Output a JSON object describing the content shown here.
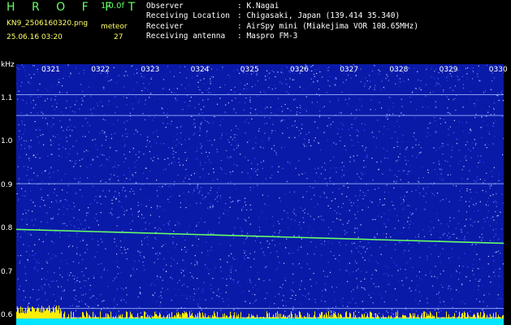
{
  "header": {
    "brand": "H R O F F T",
    "version": "1.0.0f",
    "file_name": "KN9_2506160320.png",
    "timestamp": "25.06.16 03:20",
    "meteor_label": "meteor",
    "meteor_count": "27",
    "colors": {
      "brand": "#66ff66",
      "version": "#66ff66",
      "meta": "#ffff66",
      "info": "#ffffff"
    }
  },
  "info": {
    "rows": [
      {
        "label": "Observer",
        "value": ": K.Nagai"
      },
      {
        "label": "Receiving Location",
        "value": ": Chigasaki, Japan (139.414 35.340)"
      },
      {
        "label": "Receiver",
        "value": ": AirSpy mini (Miakejima VOR 108.65MHz)"
      },
      {
        "label": "Receiving antenna",
        "value": ": Maspro FM-3"
      }
    ]
  },
  "chart_data": {
    "type": "heatmap",
    "ylabel": "kHz",
    "x_ticks": [
      "0321",
      "0322",
      "0323",
      "0324",
      "0325",
      "0326",
      "0327",
      "0328",
      "0329",
      "0330"
    ],
    "y_ticks": [
      "1.1",
      "1.0",
      "0.9",
      "0.8",
      "0.7",
      "0.6"
    ],
    "y_range": [
      0.58,
      1.18
    ],
    "carrier_line": {
      "start_khz": 0.8,
      "end_khz": 0.768
    },
    "horizontal_lines_khz": [
      1.11,
      1.062,
      0.905,
      0.618,
      0.597
    ],
    "colors": {
      "background": "#0a1aa8",
      "noise": "#5577ff",
      "carrier": "#66ff66",
      "baseline": "#00e5ff",
      "bursts": "#ffee00"
    }
  }
}
